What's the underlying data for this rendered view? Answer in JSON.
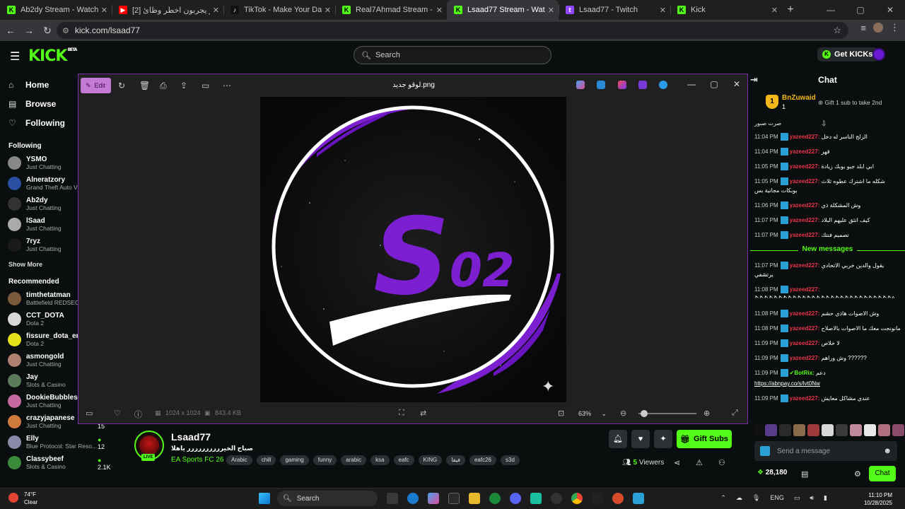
{
  "browser": {
    "tabs": [
      {
        "title": "Ab2dy Stream - Watch Live on",
        "fav_color": "#53fc18",
        "fav_text": "K"
      },
      {
        "title": "[2] اعضاء باور يجربون اخطر وظائ",
        "fav_color": "#ff0000",
        "fav_text": "▶"
      },
      {
        "title": "TikTok - Make Your Day",
        "fav_color": "#111111",
        "fav_text": "♪"
      },
      {
        "title": "Real7Ahmad Stream - Watch Li",
        "fav_color": "#53fc18",
        "fav_text": "K"
      },
      {
        "title": "Lsaad77 Stream - Watch Live o",
        "fav_color": "#53fc18",
        "fav_text": "K"
      },
      {
        "title": "Lsaad77 - Twitch",
        "fav_color": "#9146ff",
        "fav_text": "t"
      },
      {
        "title": "Kick",
        "fav_color": "#53fc18",
        "fav_text": "K"
      }
    ],
    "active_tab": 4,
    "url": "kick.com/lsaad77"
  },
  "kick": {
    "search_placeholder": "Search",
    "get_kicks": "Get KICKs",
    "logo": "KICK",
    "logo_beta": "BETA"
  },
  "sidebar": {
    "nav": [
      {
        "label": "Home",
        "icon": "home-icon",
        "glyph": "⌂"
      },
      {
        "label": "Browse",
        "icon": "browse-icon",
        "glyph": "▤"
      },
      {
        "label": "Following",
        "icon": "heart-icon",
        "glyph": "♡"
      }
    ],
    "following_header": "Following",
    "following": [
      {
        "name": "YSMO",
        "sub": "Just Chatting",
        "color": "#888888"
      },
      {
        "name": "Alneratzory",
        "sub": "Grand Theft Auto V",
        "color": "#2a4fa0"
      },
      {
        "name": "Ab2dy",
        "sub": "Just Chatting",
        "color": "#333333"
      },
      {
        "name": "lSaad",
        "sub": "Just Chatting",
        "color": "#aaaaaa"
      },
      {
        "name": "7ryz",
        "sub": "Just Chatting",
        "color": "#1a1a1a"
      }
    ],
    "show_more": "Show More",
    "recommended_header": "Recommended",
    "recommended": [
      {
        "name": "timthetatman",
        "sub": "Battlefield REDSEC",
        "color": "#7a5a3a",
        "viewers": ""
      },
      {
        "name": "CCT_DOTA",
        "sub": "Dota 2",
        "color": "#d8d8d8",
        "viewers": ""
      },
      {
        "name": "fissure_dota_en",
        "sub": "Dota 2",
        "color": "#e6e21a",
        "viewers": ""
      },
      {
        "name": "asmongold",
        "sub": "Just Chatting",
        "color": "#b08070",
        "viewers": ""
      },
      {
        "name": "Jay",
        "sub": "Slots & Casino",
        "color": "#5a7a5a",
        "viewers": ""
      },
      {
        "name": "DookieBubbles",
        "sub": "Just Chatting",
        "color": "#c46aa0",
        "viewers": ""
      },
      {
        "name": "crazyjapanese",
        "sub": "Just Chatting",
        "color": "#d07a40",
        "viewers": "15"
      },
      {
        "name": "Elly",
        "sub": "Blue Protocol: Star Reso...",
        "color": "#8a8aa8",
        "viewers": "12"
      },
      {
        "name": "Classybeef",
        "sub": "Slots & Casino",
        "color": "#3a8a3a",
        "viewers": "2.1K"
      }
    ]
  },
  "viewer": {
    "title": "لوقو جديد.png",
    "edit": "Edit",
    "dims": "1024 x 1024",
    "size": "843.4 KB",
    "zoom": "63%"
  },
  "stream": {
    "name": "Lsaad77",
    "title": "صباح الخيرررررررررر ياهلا",
    "category": "EA Sports FC 26",
    "tags": [
      "Arabic",
      "chill",
      "gaming",
      "funny",
      "arabic",
      "ksa",
      "eafc",
      "KING",
      "فيفا",
      "eafc26",
      "s3d"
    ],
    "gift_subs": "Gift Subs",
    "viewers": "5",
    "viewers_label": "Viewers",
    "live": "LIVE"
  },
  "chat": {
    "header": "Chat",
    "pinned_name": "BnZuwaid",
    "pinned_count": "1",
    "pinned_gift": "Gift 1 sub to take 2nd",
    "pinned_rank": "1",
    "top_line": "صرت صبور",
    "messages": [
      {
        "time": "11:04 PM",
        "user": "yazeed227:",
        "text": "الزلج الناسر له دخل"
      },
      {
        "time": "11:04 PM",
        "user": "yazeed227:",
        "text": "قهر"
      },
      {
        "time": "11:05 PM",
        "user": "yazeed227:",
        "text": "ابي ابلد جيو بوبك زيادة"
      },
      {
        "time": "11:05 PM",
        "user": "yazeed227:",
        "text": "شكله ما اشترك عطوه ثلاث بوبكات مجانية بس"
      },
      {
        "time": "11:06 PM",
        "user": "yazeed227:",
        "text": "وش المشكلة ذي"
      },
      {
        "time": "11:07 PM",
        "user": "yazeed227:",
        "text": "كيف انثق عليهم البلاد"
      },
      {
        "time": "11:07 PM",
        "user": "yazeed227:",
        "text": "تصميم فنتك"
      }
    ],
    "new_messages": "New messages",
    "messages2": [
      {
        "time": "11:07 PM",
        "user": "yazeed227:",
        "text": "يقول والدين خربي الاتحادي يرتشفي",
        "bot": false
      },
      {
        "time": "11:08 PM",
        "user": "yazeed227:",
        "text": "^ُ^ُ^ُ^ُ^ُ^ُ^ُ^ُ^ُ^ُ^ُ^ُ^ُ^ُ^ُ^ُ^ُ^ُ^ُ^ُ^ُ^ُ^ُ^ُ^ُ^ُ^ُ^ُ^ُ^",
        "bot": false
      },
      {
        "time": "11:08 PM",
        "user": "yazeed227:",
        "text": "وش الاصوات هاذي حشم",
        "bot": false
      },
      {
        "time": "11:08 PM",
        "user": "yazeed227:",
        "text": "مانونجت معك ما الاصوات بالاصلاح",
        "bot": false
      },
      {
        "time": "11:09 PM",
        "user": "yazeed227:",
        "text": "لا خلاص",
        "bot": false
      },
      {
        "time": "11:09 PM",
        "user": "yazeed227:",
        "text": "وش وراهم ??????",
        "bot": false
      },
      {
        "time": "11:09 PM",
        "user": "BotRix:",
        "text": "دعم",
        "bot": true
      },
      {
        "time": "",
        "user": "",
        "text": "https://abnpay.co/s/lvt0Nw",
        "bot": false,
        "link": true
      },
      {
        "time": "11:09 PM",
        "user": "yazeed227:",
        "text": "عندي مشاكل معايش",
        "bot": false
      }
    ],
    "input_placeholder": "Send a message",
    "points": "28,180",
    "chat_btn": "Chat"
  },
  "taskbar": {
    "temp": "74°F",
    "cond": "Clear",
    "search": "Search",
    "lang": "ENG",
    "time": "11:10 PM",
    "date": "10/28/2025"
  }
}
